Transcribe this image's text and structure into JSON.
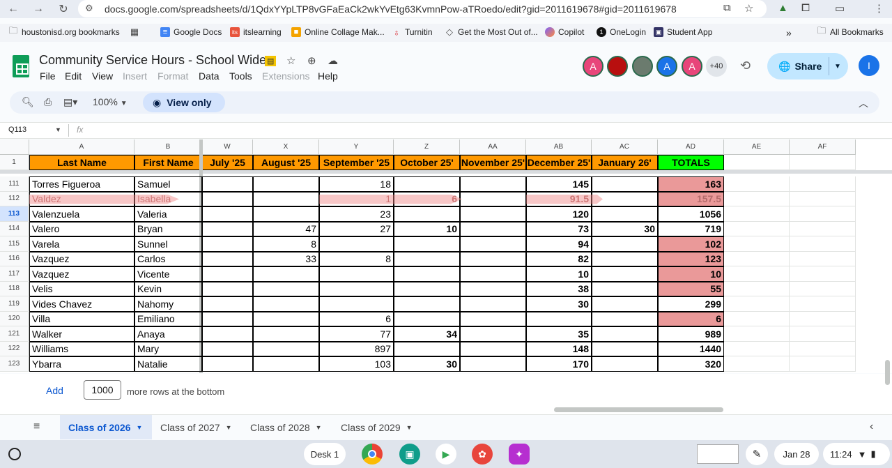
{
  "browser": {
    "url": "docs.google.com/spreadsheets/d/1QdxYYpLTP8vGFaEaCk2wkYvEtg63KvmnPow-aTRoedo/edit?gid=2011619678#gid=2011619678",
    "bookmarks": [
      {
        "label": "houstonisd.org bookmarks",
        "icon": "folder-icon"
      },
      {
        "label": "",
        "icon": "apps-grid-icon"
      },
      {
        "label": "Google Docs",
        "icon": "docs-icon",
        "color": "#4285f4"
      },
      {
        "label": "itslearning",
        "icon": "itslearning-icon",
        "color": "#e8543c"
      },
      {
        "label": "Online Collage Mak...",
        "icon": "collage-icon",
        "color": "#f4a300"
      },
      {
        "label": "Turnitin",
        "icon": "turnitin-icon",
        "color": "#d9262e"
      },
      {
        "label": "Get the Most Out of...",
        "icon": "tip-icon",
        "color": "#555555"
      },
      {
        "label": "Copilot",
        "icon": "copilot-icon",
        "color": "#7b61ff"
      },
      {
        "label": "OneLogin",
        "icon": "onelogin-icon",
        "color": "#111111"
      },
      {
        "label": "Student App",
        "icon": "student-app-icon",
        "color": "#333366"
      }
    ],
    "more_bookmarks": "»",
    "all_bookmarks": "All Bookmarks"
  },
  "app": {
    "title": "Community Service Hours - School Wide",
    "menu": [
      {
        "label": "File",
        "enabled": true
      },
      {
        "label": "Edit",
        "enabled": true
      },
      {
        "label": "View",
        "enabled": true
      },
      {
        "label": "Insert",
        "enabled": false
      },
      {
        "label": "Format",
        "enabled": false
      },
      {
        "label": "Data",
        "enabled": true
      },
      {
        "label": "Tools",
        "enabled": true
      },
      {
        "label": "Extensions",
        "enabled": false
      },
      {
        "label": "Help",
        "enabled": true
      }
    ],
    "avatars": [
      {
        "initial": "A",
        "color": "#e8457a"
      },
      {
        "initial": "",
        "color": "#b80f0f"
      },
      {
        "initial": "",
        "color": "#6b7b6e"
      },
      {
        "initial": "A",
        "color": "#1a73e8"
      },
      {
        "initial": "A",
        "color": "#e8457a"
      }
    ],
    "more_collaborators": "+40",
    "share_label": "Share",
    "user_initial": "I"
  },
  "toolbar": {
    "zoom": "100%",
    "view_only": "View only"
  },
  "formula_bar": {
    "cell_ref": "Q113",
    "fx": "fx"
  },
  "grid": {
    "col_letters": [
      "A",
      "B",
      "W",
      "X",
      "Y",
      "Z",
      "AA",
      "AB",
      "AC",
      "AD",
      "AE",
      "AF"
    ],
    "header_row_num": "1",
    "headers": [
      "Last Name",
      "First Name",
      "July '25",
      "August '25",
      "September '25",
      "October 25'",
      "November 25'",
      "December 25'",
      "January 26'",
      "TOTALS"
    ],
    "rows": [
      {
        "num": "111",
        "cells": [
          "Torres Figueroa",
          "Samuel",
          "",
          "",
          "18",
          "",
          "",
          "145",
          "",
          "163"
        ],
        "pink": true
      },
      {
        "num": "112",
        "cells": [
          "Valdez",
          "Isabella",
          "",
          "",
          "1",
          "6",
          "",
          "91.5",
          "",
          "157.5"
        ],
        "pink": true,
        "struck": true
      },
      {
        "num": "113",
        "cells": [
          "Valenzuela",
          "Valeria",
          "",
          "",
          "23",
          "",
          "",
          "120",
          "",
          "1056"
        ],
        "pink": false,
        "selected": true
      },
      {
        "num": "114",
        "cells": [
          "Valero",
          "Bryan",
          "",
          "47",
          "27",
          "10",
          "",
          "73",
          "30",
          "719"
        ],
        "pink": false
      },
      {
        "num": "115",
        "cells": [
          "Varela",
          "Sunnel",
          "",
          "8",
          "",
          "",
          "",
          "94",
          "",
          "102"
        ],
        "pink": true
      },
      {
        "num": "116",
        "cells": [
          "Vazquez",
          "Carlos",
          "",
          "33",
          "8",
          "",
          "",
          "82",
          "",
          "123"
        ],
        "pink": true
      },
      {
        "num": "117",
        "cells": [
          "Vazquez",
          "Vicente",
          "",
          "",
          "",
          "",
          "",
          "10",
          "",
          "10"
        ],
        "pink": true
      },
      {
        "num": "118",
        "cells": [
          "Velis",
          "Kevin",
          "",
          "",
          "",
          "",
          "",
          "38",
          "",
          "55"
        ],
        "pink": true
      },
      {
        "num": "119",
        "cells": [
          "Vides Chavez",
          "Nahomy",
          "",
          "",
          "",
          "",
          "",
          "30",
          "",
          "299"
        ],
        "pink": false
      },
      {
        "num": "120",
        "cells": [
          "Villa",
          "Emiliano",
          "",
          "",
          "6",
          "",
          "",
          "",
          "",
          "6"
        ],
        "pink": true
      },
      {
        "num": "121",
        "cells": [
          "Walker",
          "Anaya",
          "",
          "",
          "77",
          "34",
          "",
          "35",
          "",
          "989"
        ],
        "pink": false
      },
      {
        "num": "122",
        "cells": [
          "Williams",
          "Mary",
          "",
          "",
          "897",
          "",
          "",
          "148",
          "",
          "1440"
        ],
        "pink": false
      },
      {
        "num": "123",
        "cells": [
          "Ybarra",
          "Natalie",
          "",
          "",
          "103",
          "30",
          "",
          "170",
          "",
          "320"
        ],
        "pink": false
      }
    ],
    "colors": {
      "header_orange": "#ff9900",
      "totals_green": "#00ff00",
      "low_pink": "#ea9999"
    }
  },
  "add_rows": {
    "add_label": "Add",
    "count": "1000",
    "suffix": "more rows at the bottom"
  },
  "sheets": [
    {
      "label": "Class of 2026",
      "active": true
    },
    {
      "label": "Class of 2027",
      "active": false
    },
    {
      "label": "Class of 2028",
      "active": false
    },
    {
      "label": "Class of 2029",
      "active": false
    }
  ],
  "shelf": {
    "desk": "Desk 1",
    "date": "Jan 28",
    "time": "11:24"
  }
}
